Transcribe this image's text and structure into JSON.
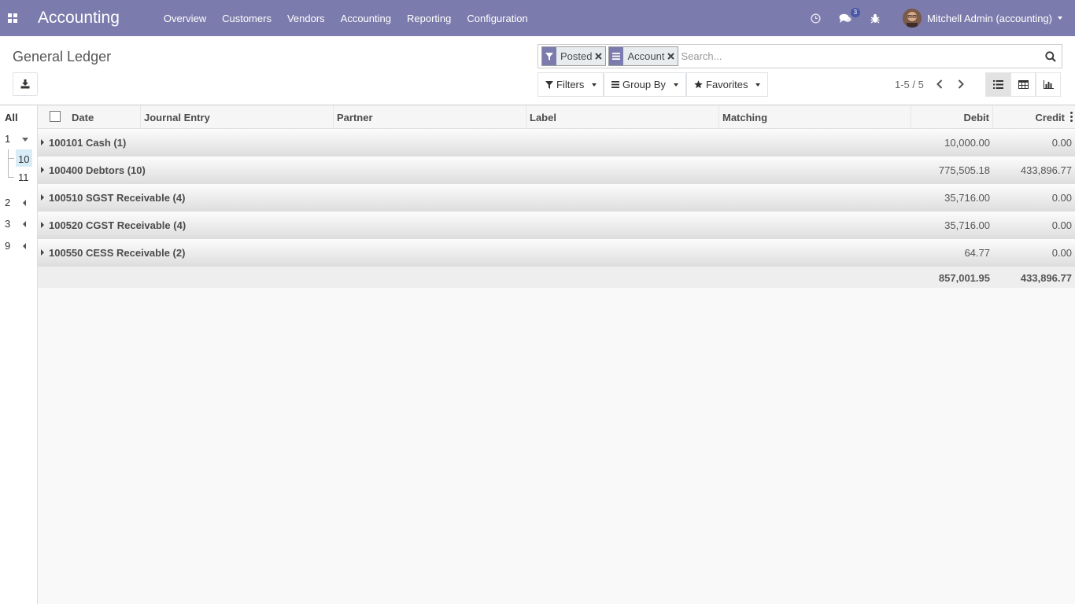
{
  "navbar": {
    "app_title": "Accounting",
    "menu": [
      "Overview",
      "Customers",
      "Vendors",
      "Accounting",
      "Reporting",
      "Configuration"
    ],
    "messages_badge": "3",
    "user_name": "Mitchell Admin (accounting)",
    "accent_color": "#7c7bad"
  },
  "control_panel": {
    "title": "General Ledger",
    "search": {
      "facets": [
        {
          "icon": "filter-icon",
          "label": "Posted"
        },
        {
          "icon": "group-by-icon",
          "label": "Account"
        }
      ],
      "placeholder": "Search..."
    },
    "filters_label": "Filters",
    "group_by_label": "Group By",
    "favorites_label": "Favorites",
    "pager": "1-5 / 5",
    "views": [
      "list-view-icon",
      "pivot-view-icon",
      "graph-view-icon"
    ]
  },
  "left_panel": {
    "all_label": "All",
    "items": [
      {
        "label": "1",
        "state": "expanded",
        "children": [
          "10",
          "11"
        ]
      },
      {
        "label": "2",
        "state": "collapsed"
      },
      {
        "label": "3",
        "state": "collapsed"
      },
      {
        "label": "9",
        "state": "collapsed"
      }
    ],
    "selected": "10"
  },
  "list": {
    "columns": [
      "Date",
      "Journal Entry",
      "Partner",
      "Label",
      "Matching",
      "Debit",
      "Credit"
    ],
    "groups": [
      {
        "label": "100101 Cash (1)",
        "debit": "10,000.00",
        "credit": "0.00"
      },
      {
        "label": "100400 Debtors (10)",
        "debit": "775,505.18",
        "credit": "433,896.77"
      },
      {
        "label": "100510 SGST Receivable (4)",
        "debit": "35,716.00",
        "credit": "0.00"
      },
      {
        "label": "100520 CGST Receivable (4)",
        "debit": "35,716.00",
        "credit": "0.00"
      },
      {
        "label": "100550 CESS Receivable (2)",
        "debit": "64.77",
        "credit": "0.00"
      }
    ],
    "totals": {
      "debit": "857,001.95",
      "credit": "433,896.77"
    }
  }
}
